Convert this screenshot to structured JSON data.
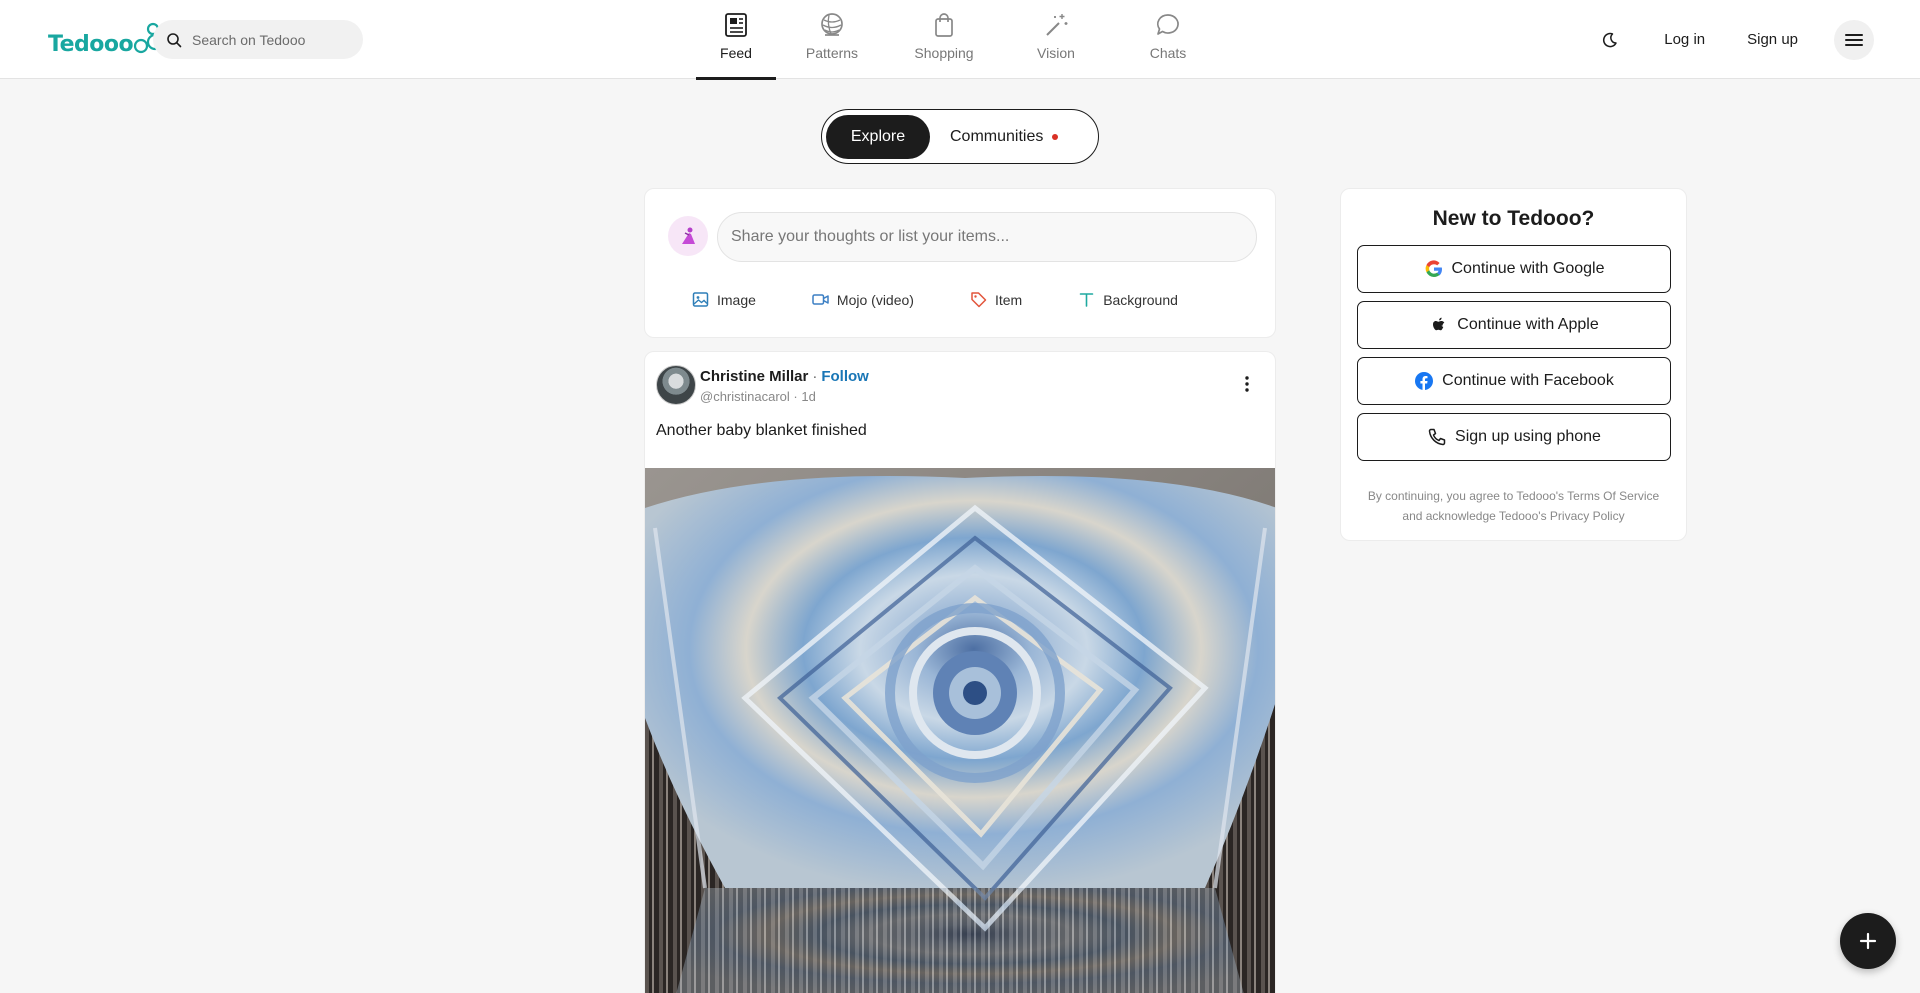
{
  "brand": {
    "name": "Tedooo",
    "color": "#19a7a0"
  },
  "search": {
    "placeholder": "Search on Tedooo"
  },
  "nav": [
    {
      "label": "Feed",
      "icon": "newspaper-icon",
      "active": true
    },
    {
      "label": "Patterns",
      "icon": "yarn-ball-icon"
    },
    {
      "label": "Shopping",
      "icon": "shopping-bag-icon"
    },
    {
      "label": "Vision",
      "icon": "magic-wand-icon"
    },
    {
      "label": "Chats",
      "icon": "chat-bubble-icon"
    }
  ],
  "header_right": {
    "login": "Log in",
    "signup": "Sign up",
    "theme_icon": "moon-icon",
    "menu_icon": "hamburger-icon"
  },
  "segment": {
    "explore": "Explore",
    "communities": "Communities"
  },
  "composer": {
    "placeholder": "Share your thoughts or list your items...",
    "actions": [
      {
        "label": "Image",
        "icon": "image-icon",
        "color": "#2f7fb8"
      },
      {
        "label": "Mojo (video)",
        "icon": "video-icon",
        "color": "#3b7fc4"
      },
      {
        "label": "Item",
        "icon": "tag-icon",
        "color": "#e2553c"
      },
      {
        "label": "Background",
        "icon": "text-icon",
        "color": "#1fa9a0"
      }
    ]
  },
  "post": {
    "author": "Christine Millar",
    "separator": "·",
    "follow": "Follow",
    "handle": "@christinacarol · 1d",
    "text": "Another baby blanket finished"
  },
  "auth": {
    "title": "New to Tedooo?",
    "google": "Continue with Google",
    "apple": "Continue with Apple",
    "facebook": "Continue with Facebook",
    "phone": "Sign up using phone",
    "legal_line1": "By continuing, you agree to Tedooo's Terms Of Service",
    "legal_line2": "and acknowledge Tedooo's Privacy Policy"
  },
  "colors": {
    "accent_dark": "#1c1c1c",
    "follow_blue": "#1976b6",
    "notification_red": "#d93025"
  }
}
